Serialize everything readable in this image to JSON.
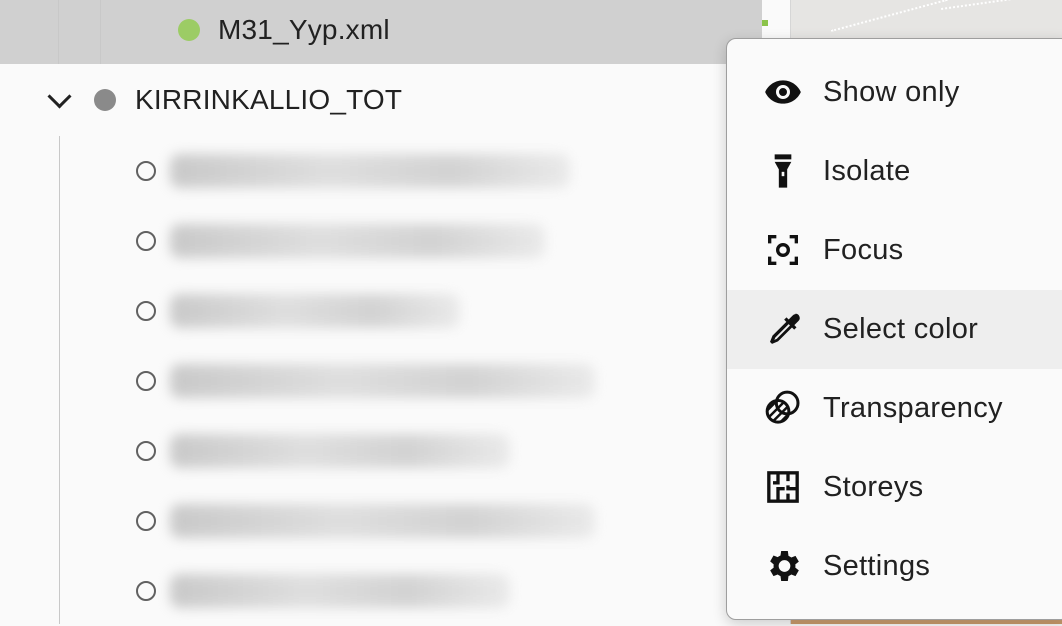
{
  "tree": {
    "selected_item": {
      "label": "M31_Yyp.xml",
      "status_color": "#9ccc65"
    },
    "group": {
      "label": "KIRRINKALLIO_TOT",
      "status_color": "#8a8a8a"
    },
    "children": [
      {
        "label": ""
      },
      {
        "label": ""
      },
      {
        "label": ""
      },
      {
        "label": ""
      },
      {
        "label": ""
      },
      {
        "label": ""
      },
      {
        "label": ""
      }
    ]
  },
  "context_menu": {
    "items": [
      {
        "label": "Show only",
        "icon": "eye-icon"
      },
      {
        "label": "Isolate",
        "icon": "flashlight-icon"
      },
      {
        "label": "Focus",
        "icon": "focus-icon"
      },
      {
        "label": "Select color",
        "icon": "eyedropper-icon",
        "highlighted": true
      },
      {
        "label": "Transparency",
        "icon": "transparency-icon"
      },
      {
        "label": "Storeys",
        "icon": "floorplan-icon"
      },
      {
        "label": "Settings",
        "icon": "gear-icon"
      }
    ]
  },
  "colors": {
    "selected_row_bg": "#d0d0d0",
    "menu_hover_bg": "#eeeeee",
    "menu_border": "#9e9e9e"
  }
}
